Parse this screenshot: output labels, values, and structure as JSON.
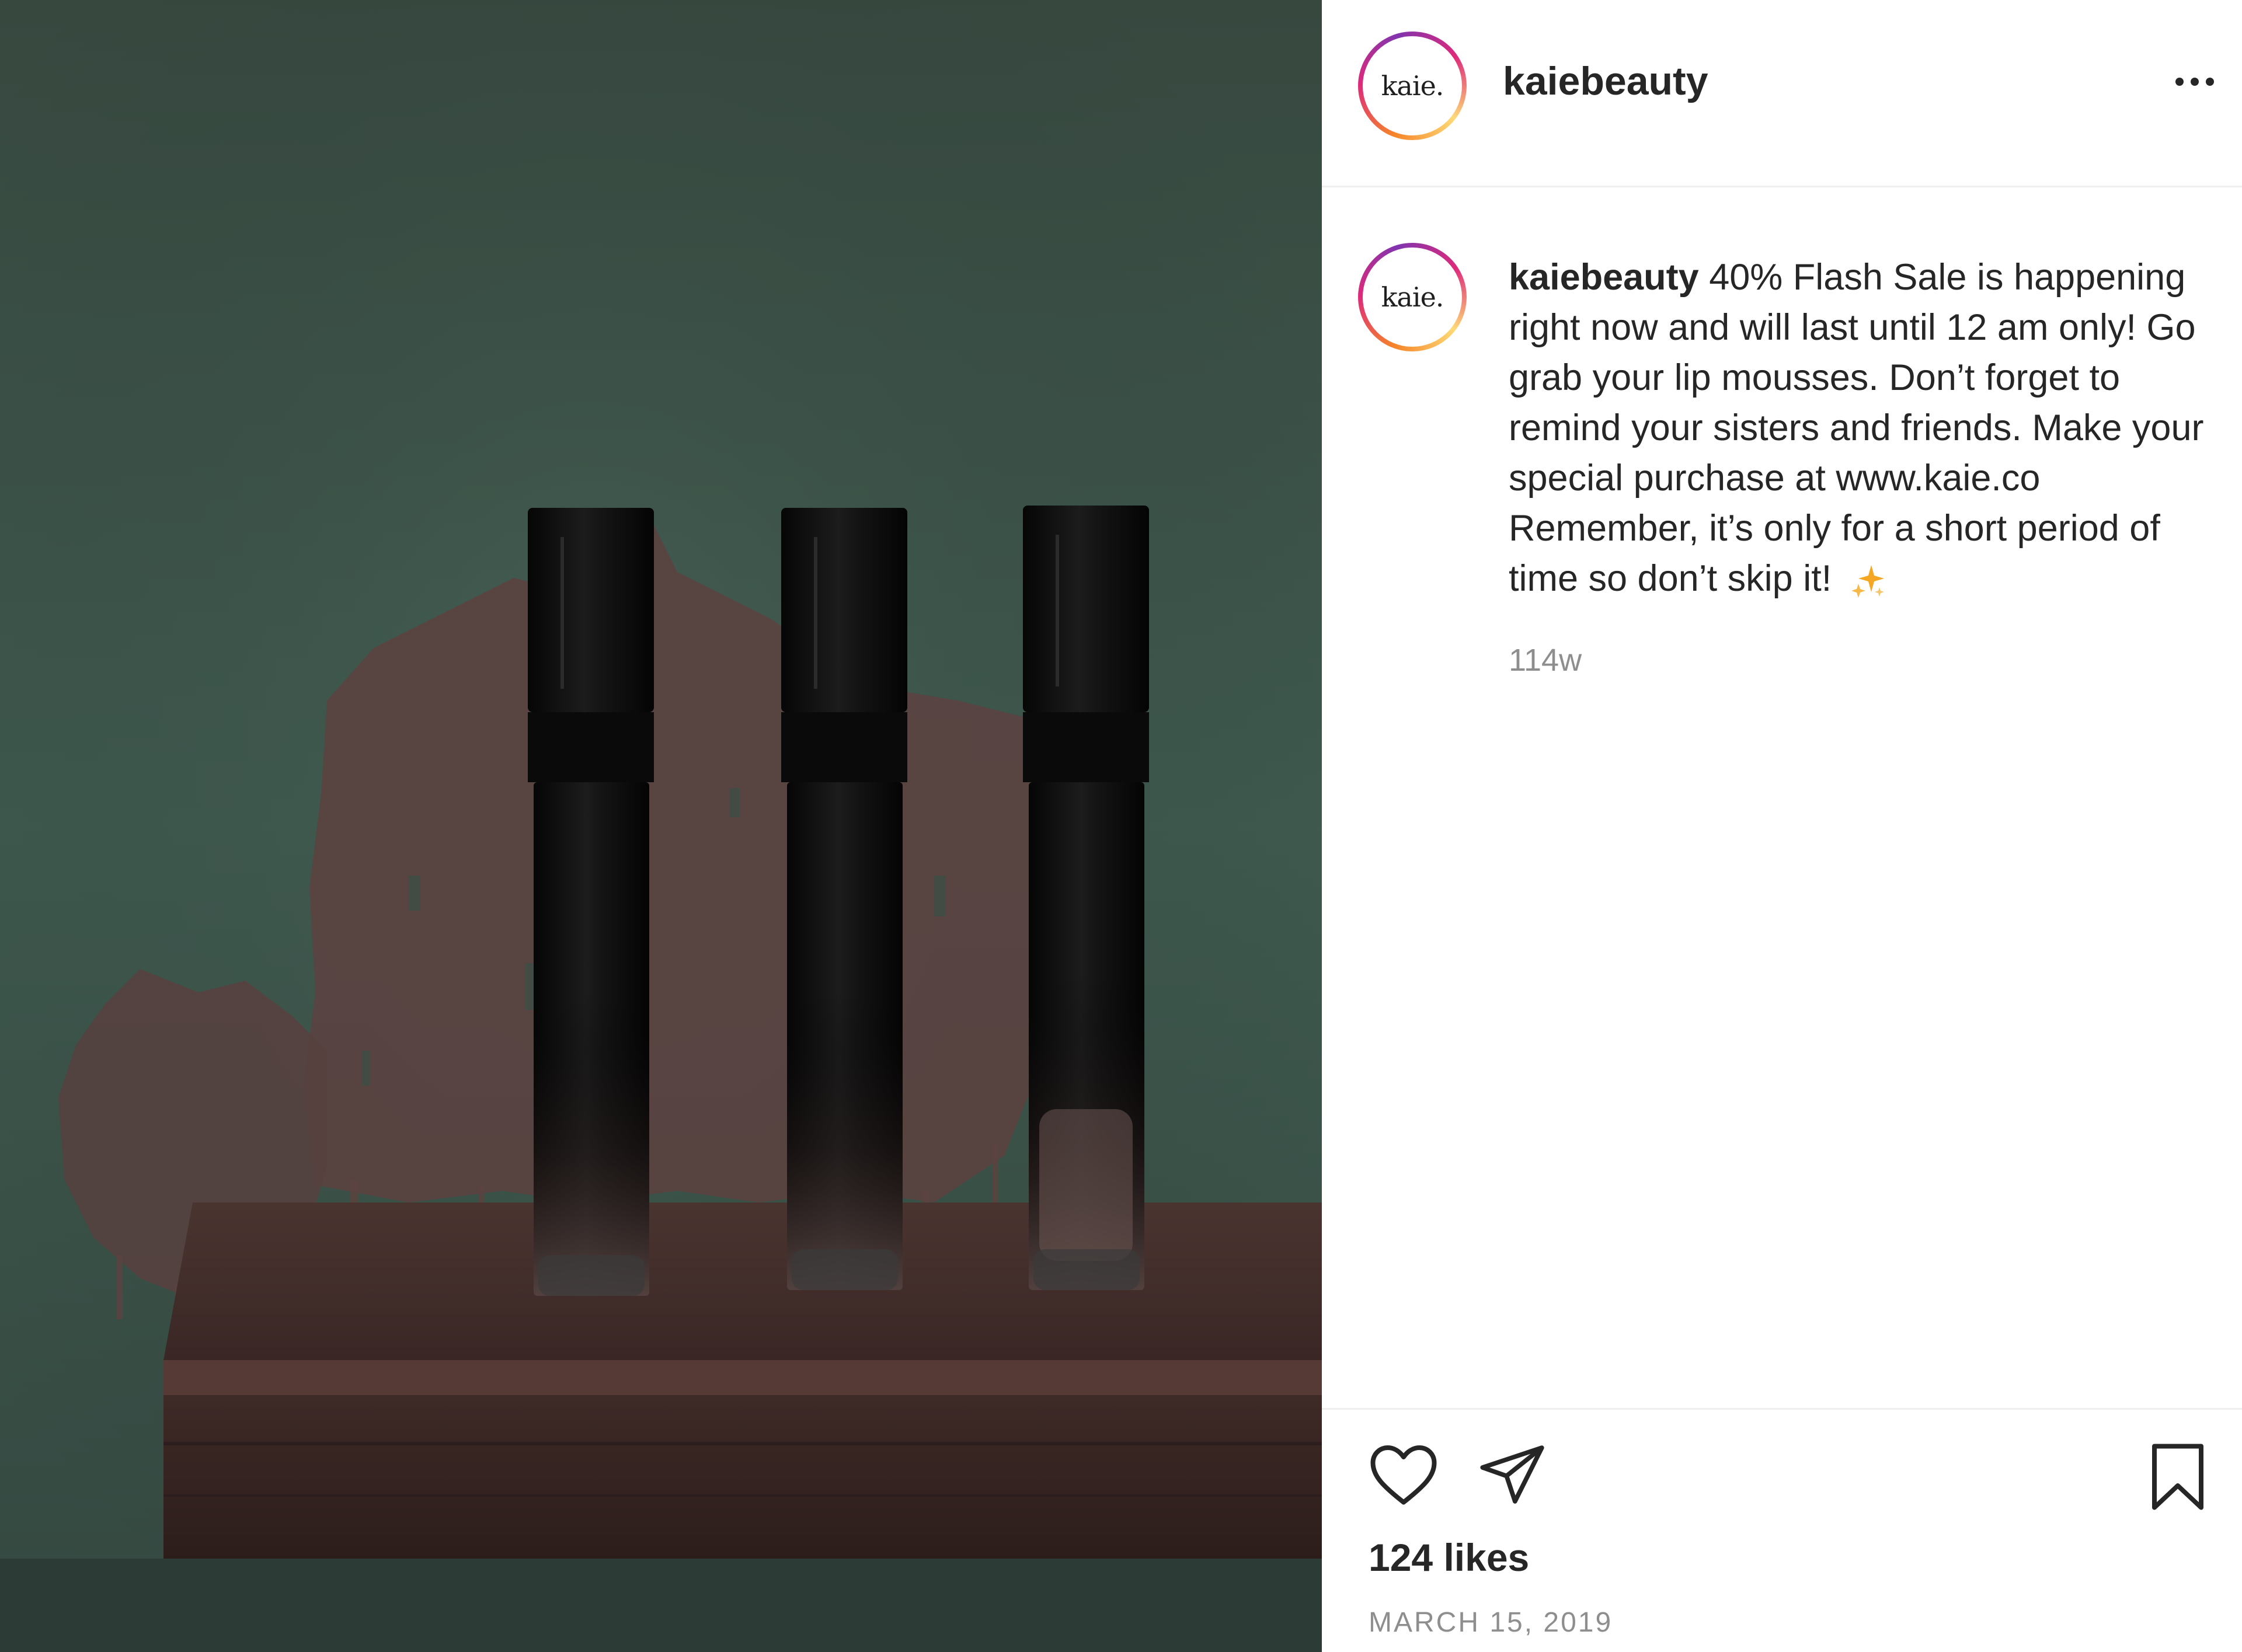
{
  "photo": {
    "description_colors": {
      "wall": "#3b4f47",
      "paint": "#5c4542",
      "table": "#3d2a27",
      "tube": "#0d0d0d"
    }
  },
  "header": {
    "avatar_logo": "kaie.",
    "username": "kaiebeauty",
    "more_icon": "more-horizontal-icon"
  },
  "caption": {
    "avatar_logo": "kaie.",
    "username": "kaiebeauty",
    "text": "40% Flash Sale is happening right now and will last until 12 am only! Go grab your lip mousses. Don’t forget to remind your sisters and friends. Make your special purchase at www.kaie.co Remember, it’s only for a short period of time so don’t skip it!",
    "emoji_icon": "sparkles-icon",
    "timestamp": "114w"
  },
  "actions": {
    "like_icon": "heart-icon",
    "share_icon": "paper-plane-icon",
    "save_icon": "bookmark-icon"
  },
  "likes": "124 likes",
  "date": "MARCH 15, 2019",
  "colors": {
    "text": "#262626",
    "muted": "#8e8e8e",
    "divider": "#efefef",
    "sparkle": "#f5a623"
  }
}
